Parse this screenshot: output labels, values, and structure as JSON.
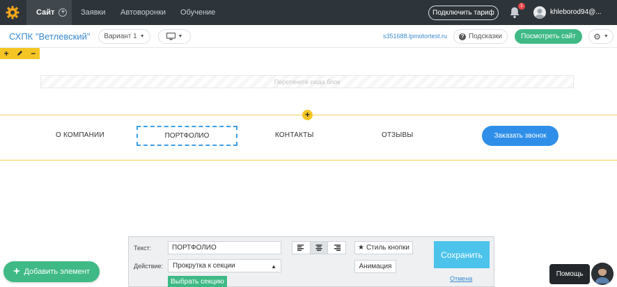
{
  "topbar": {
    "tabs": [
      {
        "label": "Сайт",
        "active": true
      },
      {
        "label": "Заявки"
      },
      {
        "label": "Автоворонки"
      },
      {
        "label": "Обучение"
      }
    ],
    "connect_plan_label": "Подключить тариф",
    "notifications_count": "1",
    "username": "khleborod94@..."
  },
  "subbar": {
    "project_name": "СХПК \"Ветлевский\"",
    "variant_label": "Вариант 1",
    "domain": "s351688.lpmotortest.ru",
    "hints_label": "Подсказки",
    "view_site_label": "Посмотреть сайт"
  },
  "canvas": {
    "dropzone_text": "Перетяните сюда блок",
    "menu_items": [
      "О КОМПАНИИ",
      "ПОРТФОЛИО",
      "КОНТАКТЫ",
      "ОТЗЫВЫ"
    ],
    "cta_label": "Заказать звонок"
  },
  "editor": {
    "text_label": "Текст:",
    "text_value": "ПОРТФОЛИО",
    "action_label": "Действие:",
    "action_value": "Прокрутка к секции",
    "pick_section_label": "Выбрать секцию",
    "button_style_label": "Стиль кнопки",
    "animation_label": "Анимация",
    "save_label": "Сохранить",
    "cancel_label": "Отмена"
  },
  "floating": {
    "add_element_label": "Добавить элемент",
    "help_label": "Помощь"
  },
  "colors": {
    "topbar_bg": "#2e353a",
    "accent_green": "#3fba86",
    "accent_blue": "#2f8fe8",
    "highlight_yellow": "#f4c525",
    "save_blue": "#4cc3ea"
  }
}
